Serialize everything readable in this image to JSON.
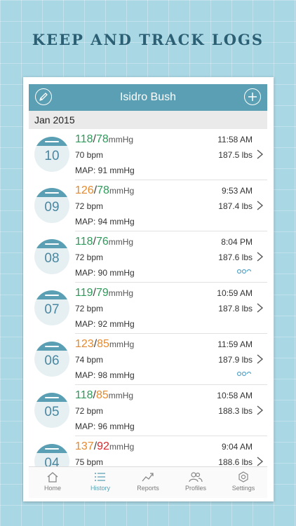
{
  "headline": "KEEP AND TRACK LOGS",
  "header": {
    "title": "Isidro Bush"
  },
  "section": {
    "label": "Jan 2015"
  },
  "entries": [
    {
      "day": "10",
      "sys": "118",
      "dia": "78",
      "sys_color": "g",
      "dia_color": "g",
      "unit": "mmHg",
      "bpm": "70 bpm",
      "map": "MAP: 91 mmHg",
      "time": "11:58 AM",
      "weight": "187.5 lbs",
      "note": false
    },
    {
      "day": "09",
      "sys": "126",
      "dia": "78",
      "sys_color": "o",
      "dia_color": "g",
      "unit": "mmHg",
      "bpm": "72 bpm",
      "map": "MAP: 94 mmHg",
      "time": "9:53 AM",
      "weight": "187.4 lbs",
      "note": false
    },
    {
      "day": "08",
      "sys": "118",
      "dia": "76",
      "sys_color": "g",
      "dia_color": "g",
      "unit": "mmHg",
      "bpm": "72 bpm",
      "map": "MAP: 90 mmHg",
      "time": "8:04 PM",
      "weight": "187.6 lbs",
      "note": true
    },
    {
      "day": "07",
      "sys": "119",
      "dia": "79",
      "sys_color": "g",
      "dia_color": "g",
      "unit": "mmHg",
      "bpm": "72 bpm",
      "map": "MAP: 92 mmHg",
      "time": "10:59 AM",
      "weight": "187.8 lbs",
      "note": false
    },
    {
      "day": "06",
      "sys": "123",
      "dia": "85",
      "sys_color": "o",
      "dia_color": "o",
      "unit": "mmHg",
      "bpm": "74 bpm",
      "map": "MAP: 98 mmHg",
      "time": "11:59 AM",
      "weight": "187.9 lbs",
      "note": true
    },
    {
      "day": "05",
      "sys": "118",
      "dia": "85",
      "sys_color": "g",
      "dia_color": "o",
      "unit": "mmHg",
      "bpm": "72 bpm",
      "map": "MAP: 96 mmHg",
      "time": "10:58 AM",
      "weight": "188.3 lbs",
      "note": false
    },
    {
      "day": "04",
      "sys": "137",
      "dia": "92",
      "sys_color": "o",
      "dia_color": "r",
      "unit": "mmHg",
      "bpm": "75 bpm",
      "map": "",
      "time": "9:04 AM",
      "weight": "188.6 lbs",
      "note": false
    }
  ],
  "tabs": [
    {
      "label": "Home",
      "icon": "home-icon"
    },
    {
      "label": "History",
      "icon": "list-icon"
    },
    {
      "label": "Reports",
      "icon": "trend-icon"
    },
    {
      "label": "Profiles",
      "icon": "people-icon"
    },
    {
      "label": "Settings",
      "icon": "gear-icon"
    }
  ],
  "colors": {
    "accent": "#5a9fb3",
    "normal": "#2e9a5a",
    "elevated": "#e58a2e",
    "high": "#d9252b",
    "background": "#a9d7e4",
    "headline": "#2b5f73"
  }
}
